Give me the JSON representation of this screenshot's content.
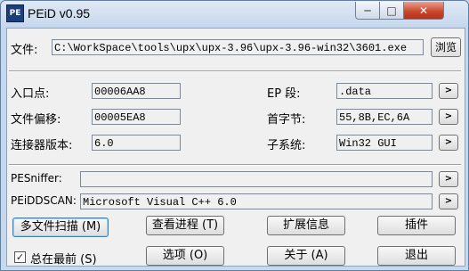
{
  "window": {
    "title": "PEiD v0.95",
    "icon_text": "PE",
    "controls": {
      "minimize": "─",
      "maximize": "□",
      "close": "✕"
    }
  },
  "file": {
    "label": "文件:",
    "path": "C:\\WorkSpace\\tools\\upx\\upx-3.96\\upx-3.96-win32\\3601.exe",
    "browse": "浏览"
  },
  "info": {
    "entry_point": {
      "label": "入口点:",
      "value": "00006AA8"
    },
    "file_offset": {
      "label": "文件偏移:",
      "value": "00005EA8"
    },
    "linker_version": {
      "label": "连接器版本:",
      "value": "6.0"
    },
    "ep_section": {
      "label": "EP 段:",
      "value": ".data"
    },
    "first_bytes": {
      "label": "首字节:",
      "value": "55,8B,EC,6A"
    },
    "subsystem": {
      "label": "子系统:",
      "value": "Win32 GUI"
    },
    "arrow": ">"
  },
  "scan": {
    "pesniffer": {
      "label": "PESniffer:",
      "value": ""
    },
    "peiddscan": {
      "label": "PEiDDSCAN:",
      "value": "Microsoft Visual C++ 6.0"
    }
  },
  "buttons": {
    "multi_scan": "多文件扫描 (M)",
    "view_process": "查看进程 (T)",
    "extensions": "扩展信息",
    "plugins": "插件",
    "options": "选项 (O)",
    "about": "关于 (A)",
    "exit": "退出"
  },
  "always_on_top": {
    "label": "总在最前 (S)",
    "checked": true,
    "mark": "✓"
  }
}
